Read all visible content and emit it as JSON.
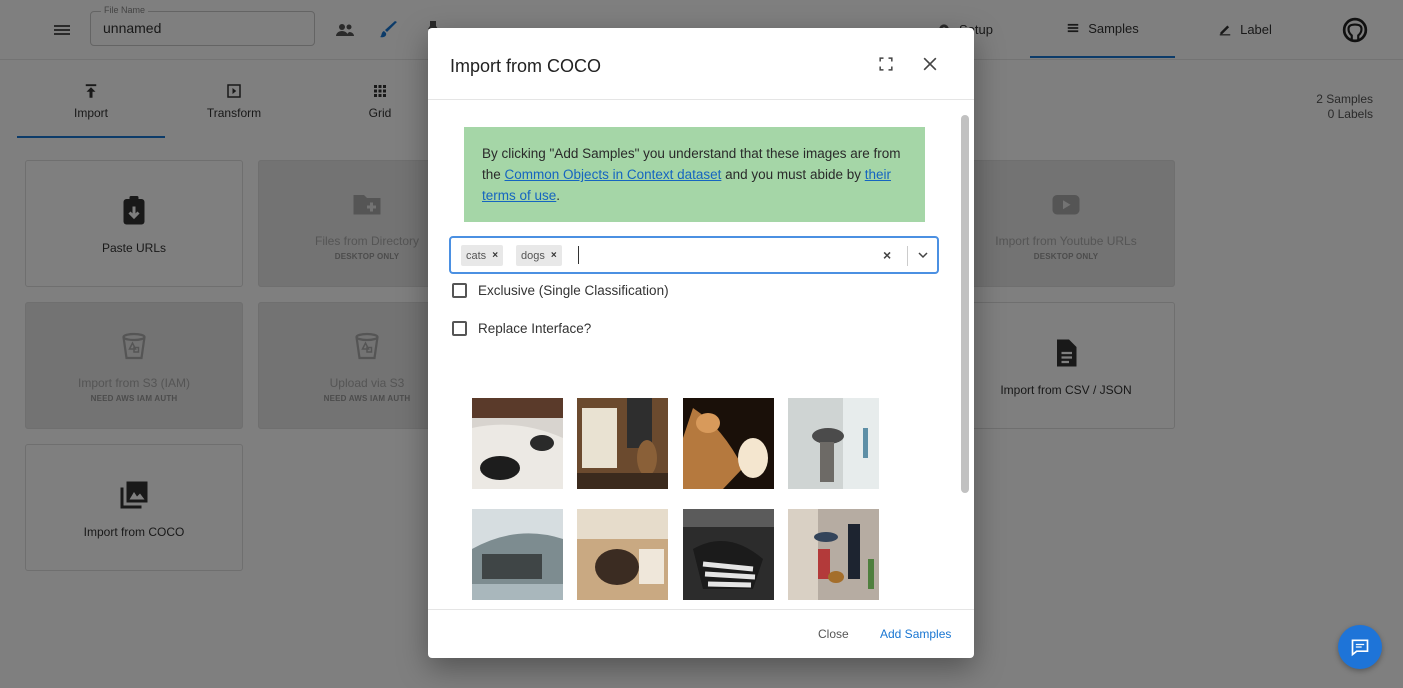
{
  "header": {
    "file_name_label": "File Name",
    "file_name_value": "unnamed",
    "nav": [
      {
        "label": "Setup"
      },
      {
        "label": "Samples"
      },
      {
        "label": "Label"
      }
    ]
  },
  "subtabs": [
    {
      "label": "Import"
    },
    {
      "label": "Transform"
    },
    {
      "label": "Grid"
    }
  ],
  "counts": {
    "samples": "2 Samples",
    "labels": "0 Labels"
  },
  "cards": [
    {
      "label": "Paste URLs",
      "sub": ""
    },
    {
      "label": "Files from Directory",
      "sub": "DESKTOP ONLY"
    },
    {
      "label": "Import from Youtube URLs",
      "sub": "DESKTOP ONLY"
    },
    {
      "label": "Import from S3 (IAM)",
      "sub": "NEED AWS IAM AUTH"
    },
    {
      "label": "Upload via S3",
      "sub": "NEED AWS IAM AUTH"
    },
    {
      "label": "Import from CSV / JSON",
      "sub": ""
    },
    {
      "label": "Import from COCO",
      "sub": ""
    }
  ],
  "dialog": {
    "title": "Import from COCO",
    "notice": {
      "text_1": "By clicking \"Add Samples\" you understand that these images are from the ",
      "link_1": "Common Objects in Context dataset",
      "text_2": " and you must abide by ",
      "link_2": "their terms of use",
      "text_3": "."
    },
    "chips": [
      {
        "label": "cats"
      },
      {
        "label": "dogs"
      }
    ],
    "clear_symbol": "×",
    "chip_remove_symbol": "×",
    "exclusive_label": "Exclusive (Single Classification)",
    "replace_label": "Replace Interface?",
    "close_label": "Close",
    "add_label": "Add Samples"
  },
  "colors": {
    "accent": "#1976d2",
    "notice_bg": "#a5d6a7",
    "fab": "#1e74d8",
    "select_border": "#4b90e2"
  }
}
